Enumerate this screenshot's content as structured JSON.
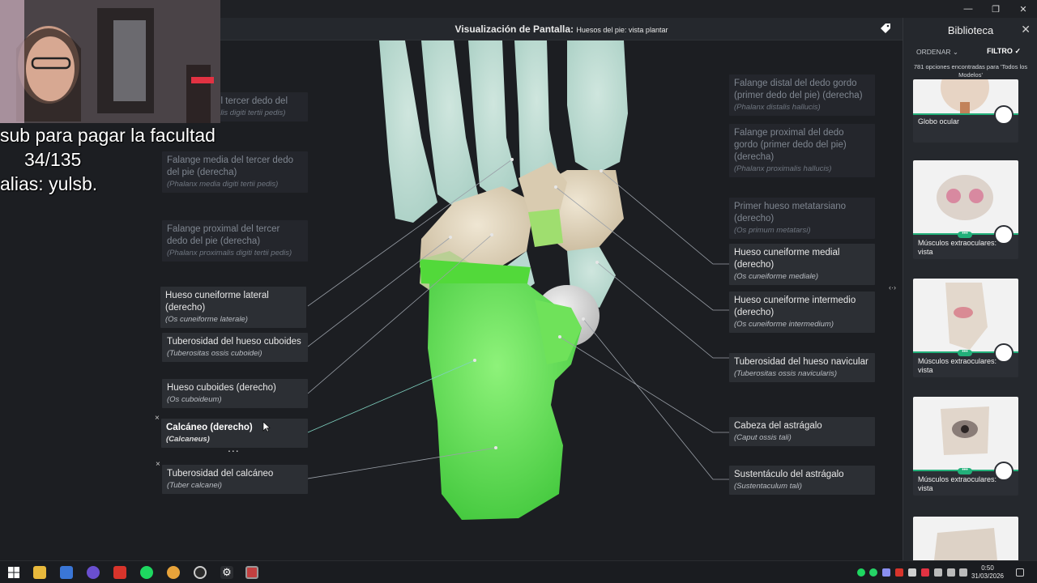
{
  "window": {
    "minimize": "—",
    "restore": "❐",
    "close": "✕"
  },
  "viewer": {
    "title_main": "Visualización de Pantalla:",
    "title_sub": "Huesos del pie: vista plantar"
  },
  "overlay": {
    "line1": "sub para pagar la facultad",
    "line2": "34/135",
    "line3": "alias: yulsb."
  },
  "labels_left": [
    {
      "name": "l del tercer dedo del",
      "latin": "(Phalanx distalis digiti tertii pedis)"
    },
    {
      "name": "Falange media del tercer dedo del pie (derecha)",
      "latin": "(Phalanx media digiti tertii pedis)"
    },
    {
      "name": "Falange proximal del tercer dedo del pie (derecha)",
      "latin": "(Phalanx proximalis digiti tertii pedis)"
    },
    {
      "name": "Hueso cuneiforme lateral (derecho)",
      "latin": "(Os cuneiforme laterale)"
    },
    {
      "name": "Tuberosidad del hueso cuboides",
      "latin": "(Tuberositas ossis cuboidei)"
    },
    {
      "name": "Hueso cuboides (derecho)",
      "latin": "(Os cuboideum)"
    },
    {
      "name": "Calcáneo (derecho)",
      "latin": "(Calcaneus)"
    },
    {
      "name": "Tuberosidad del calcáneo",
      "latin": "(Tuber calcanei)"
    }
  ],
  "labels_right": [
    {
      "name": "Falange distal del dedo gordo (primer dedo del pie) (derecha)",
      "latin": "(Phalanx distalis hallucis)"
    },
    {
      "name": "Falange proximal del dedo gordo (primer dedo del pie) (derecha)",
      "latin": "(Phalanx proximalis hallucis)"
    },
    {
      "name": "Primer hueso metatarsiano (derecho)",
      "latin": "(Os primum metatarsi)"
    },
    {
      "name": "Hueso cuneiforme medial (derecho)",
      "latin": "(Os cuneiforme mediale)"
    },
    {
      "name": "Hueso cuneiforme intermedio (derecho)",
      "latin": "(Os cuneiforme intermedium)"
    },
    {
      "name": "Tuberosidad del hueso navicular",
      "latin": "(Tuberositas ossis navicularis)"
    },
    {
      "name": "Cabeza del astrágalo",
      "latin": "(Caput ossis tali)"
    },
    {
      "name": "Sustentáculo del astrágalo",
      "latin": "(Sustentaculum tali)"
    }
  ],
  "label_controls": {
    "close": "×",
    "more": "..."
  },
  "library": {
    "title": "Biblioteca",
    "close": "✕",
    "sort_label": "ORDENAR",
    "filter_label": "FILTRO",
    "results_text": "781 opciones encontradas para 'Todos los Modelos'",
    "cards": [
      {
        "caption": "Globo ocular"
      },
      {
        "caption": "Músculos extraoculares: vista"
      },
      {
        "caption": "Músculos extraoculares: vista"
      },
      {
        "caption": "Músculos extraoculares: vista"
      },
      {
        "caption": ""
      }
    ],
    "card_pill": "•••"
  },
  "taskbar": {
    "time": "0:50",
    "date": "31/03/2026"
  },
  "colors": {
    "highlight_green": "#5fe04a",
    "bone": "#e4d9c2",
    "accent": "#23b07a"
  }
}
